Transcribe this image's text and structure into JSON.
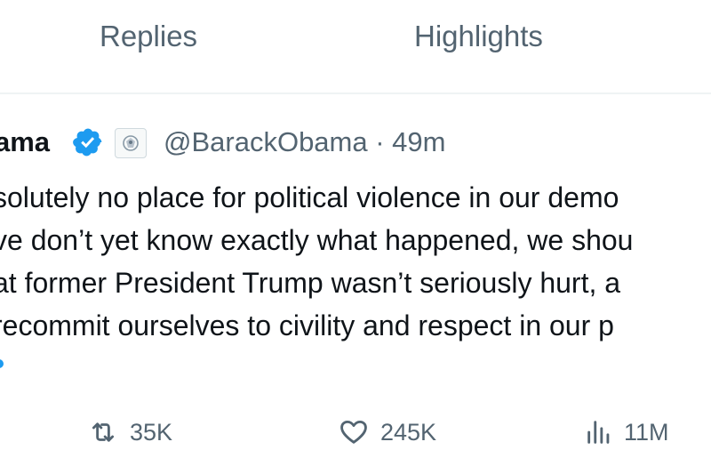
{
  "tabs": [
    {
      "label": "Replies"
    },
    {
      "label": "Highlights"
    }
  ],
  "post": {
    "author_name": "ama",
    "handle_time": "@BarackObama · 49m",
    "body_lines": [
      "solutely no place for political violence in our demo",
      "ve don’t yet know exactly what happened, we shou",
      "at former President Trump wasn’t seriously hurt, a",
      " recommit ourselves to civility and respect in our p"
    ],
    "verified_color": "#1d9bf0"
  },
  "actions": {
    "reposts": "35K",
    "likes": "245K",
    "views": "11M"
  }
}
